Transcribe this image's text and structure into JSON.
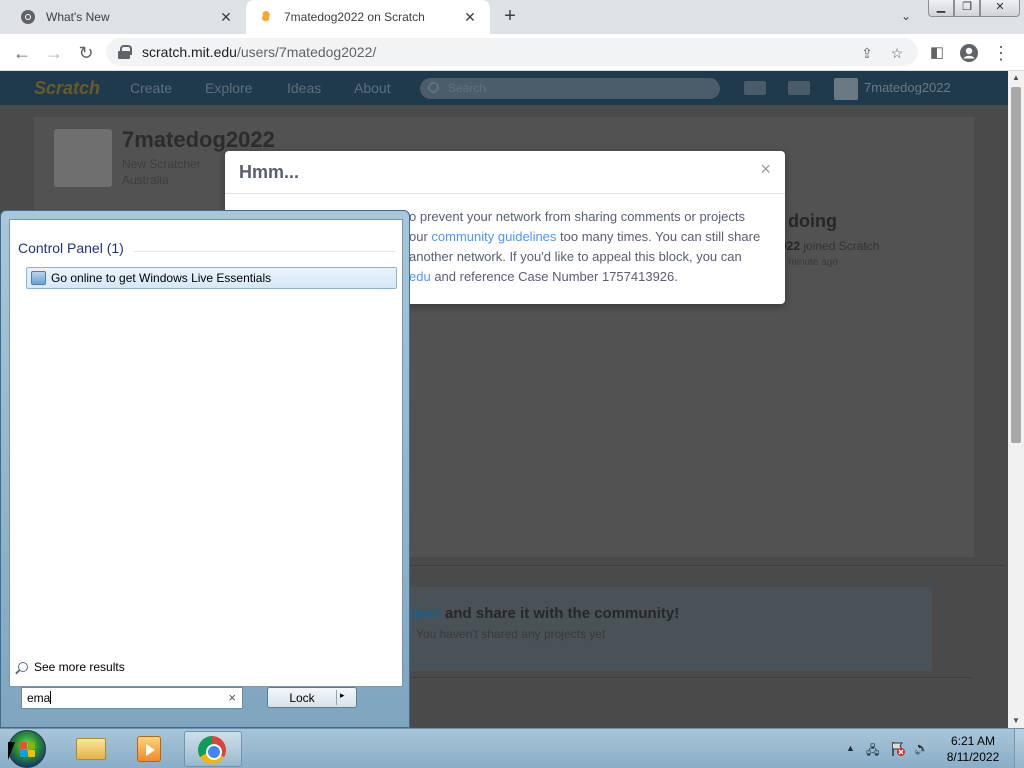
{
  "browser": {
    "tabs": [
      {
        "title": "What's New",
        "active": false,
        "favicon": "chrome-icon"
      },
      {
        "title": "7matedog2022 on Scratch",
        "active": true,
        "favicon": "scratch-icon"
      }
    ],
    "new_tab": "+",
    "tab_search": "⌄",
    "window_controls": {
      "minimize": "▁",
      "restore": "❐",
      "close": "✕"
    },
    "url_host": "scratch.mit.edu",
    "url_path": "/users/7matedog2022/"
  },
  "scratch": {
    "logo": "Scratch",
    "nav": [
      "Create",
      "Explore",
      "Ideas",
      "About"
    ],
    "search_placeholder": "Search",
    "username": "7matedog2022",
    "profile": {
      "name": "7matedog2022",
      "status": "New Scratcher",
      "location": "Australia"
    },
    "what_doing": "What I've been doing",
    "what_doing_visible": "een doing",
    "activity_user": "7matedog2022",
    "activity_user_visible": "022",
    "activity_text": " joined Scratch",
    "activity_time": "1 minute ago",
    "share": {
      "link": "roject",
      "text": " and share it with the community!",
      "sub": "You haven't shared any projects yet"
    }
  },
  "modal": {
    "title": "Hmm...",
    "close": "×",
    "lines": [
      {
        "pre": "o prevent your network from sharing comments or projects"
      },
      {
        "pre": "our ",
        "link": "community guidelines",
        "post": " too many times. You can still share"
      },
      {
        "pre": "another network. If you'd like to appeal this block, you can"
      },
      {
        "link": "edu",
        "post": " and reference Case Number 1757413926."
      }
    ]
  },
  "start_menu": {
    "group_title": "Control Panel (1)",
    "result": "Go online to get Windows Live Essentials",
    "see_more": "See more results",
    "search_value": "ema",
    "clear": "×",
    "lock_label": "Lock",
    "lock_arrow": "▸"
  },
  "taskbar": {
    "apps": [
      "windows-explorer",
      "windows-media-player",
      "google-chrome"
    ],
    "tray": {
      "show_hidden": "▲",
      "network": "🖧",
      "volume": "🔊"
    },
    "time": "6:21 AM",
    "date": "8/11/2022"
  },
  "colors": {
    "scratch_overlay": "#4a4a4a",
    "link": "#4c97ff",
    "modal_title": "#575e75"
  }
}
